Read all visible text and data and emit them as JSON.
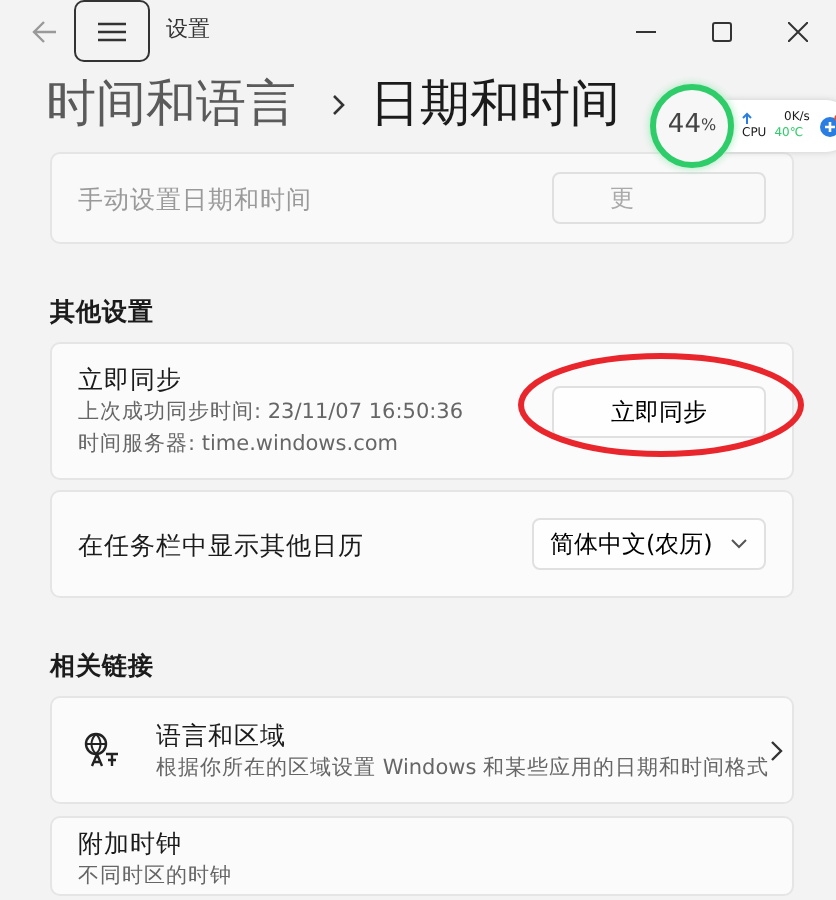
{
  "window": {
    "title": "设置"
  },
  "breadcrumb": {
    "parent": "时间和语言",
    "current": "日期和时间"
  },
  "manual_setting": {
    "label": "手动设置日期和时间",
    "button": "更",
    "disabled": true
  },
  "sections": [
    {
      "title": "其他设置",
      "items": [
        {
          "kind": "button",
          "title": "立即同步",
          "subtitle_lines": [
            "上次成功同步时间: 23/11/07 16:50:36",
            "时间服务器: time.windows.com"
          ],
          "button": "立即同步",
          "circled": true
        },
        {
          "kind": "dropdown",
          "title": "在任务栏中显示其他日历",
          "value": "简体中文(农历)"
        }
      ]
    },
    {
      "title": "相关链接",
      "items": [
        {
          "kind": "link",
          "title": "语言和区域",
          "subtitle_lines": [
            "根据你所在的区域设置 Windows 和某些应用的日期和时间格式"
          ]
        },
        {
          "kind": "plain",
          "title": "附加时钟",
          "subtitle_lines": [
            "不同时区的时钟"
          ]
        }
      ]
    }
  ],
  "monitor_widget": {
    "percent": "44",
    "unit": "%",
    "upload": "0K/s",
    "cpu_label": "CPU",
    "cpu_temp": "40℃"
  }
}
